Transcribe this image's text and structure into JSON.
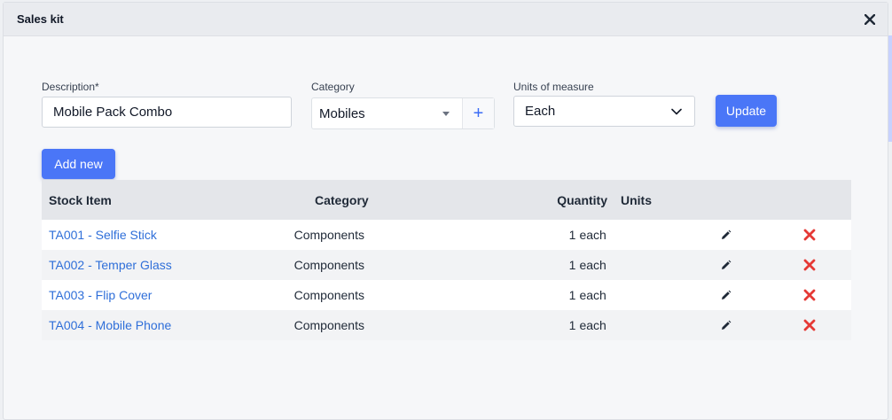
{
  "modal": {
    "title": "Sales kit",
    "close_icon": "close-icon"
  },
  "form": {
    "description": {
      "label": "Description*",
      "value": "Mobile Pack Combo"
    },
    "category": {
      "label": "Category",
      "value": "Mobiles",
      "add_icon": "+"
    },
    "units": {
      "label": "Units of measure",
      "value": "Each"
    },
    "update_label": "Update",
    "add_new_label": "Add new"
  },
  "table": {
    "headers": {
      "stock_item": "Stock Item",
      "category": "Category",
      "quantity": "Quantity",
      "units": "Units"
    },
    "rows": [
      {
        "item": "TA001 - Selfie Stick",
        "category": "Components",
        "quantity": "1",
        "units": "each"
      },
      {
        "item": "TA002 - Temper Glass",
        "category": "Components",
        "quantity": "1",
        "units": "each"
      },
      {
        "item": "TA003 - Flip Cover",
        "category": "Components",
        "quantity": "1",
        "units": "each"
      },
      {
        "item": "TA004 - Mobile Phone",
        "category": "Components",
        "quantity": "1",
        "units": "each"
      }
    ]
  },
  "colors": {
    "primary": "#4a76f7",
    "link": "#2f6fd9",
    "delete": "#e53935"
  }
}
